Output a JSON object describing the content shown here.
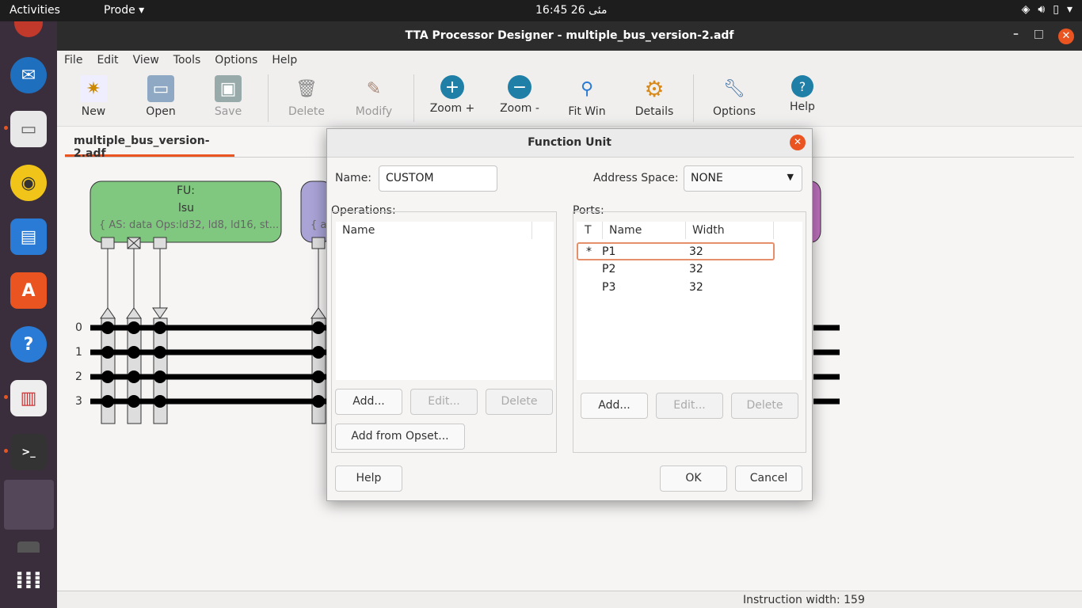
{
  "topbar": {
    "activities": "Activities",
    "app_menu": "Prode ▾",
    "clock": "16:45  مئی 26"
  },
  "window": {
    "title": "TTA Processor Designer - multiple_bus_version-2.adf",
    "minimize": "–",
    "maximize": "□",
    "close": "✕"
  },
  "menu": [
    "File",
    "Edit",
    "View",
    "Tools",
    "Options",
    "Help"
  ],
  "toolbar": {
    "new": "New",
    "open": "Open",
    "save": "Save",
    "delete": "Delete",
    "modify": "Modify",
    "zoom_in": "Zoom +",
    "zoom_out": "Zoom -",
    "fit": "Fit Win",
    "details": "Details",
    "options": "Options",
    "help": "Help"
  },
  "tab": "multiple_bus_version-2.adf",
  "canvas": {
    "fu_title": "FU:",
    "fu_name": "lsu",
    "fu_info": "{ AS: data Ops:ld32, ld8, ld16, st...",
    "fu2_info": "{ a",
    "buses": [
      "0",
      "1",
      "2",
      "3"
    ]
  },
  "status": "Instruction width: 159",
  "dialog": {
    "title": "Function Unit",
    "close": "✕",
    "name_label": "Name:",
    "name_value": "CUSTOM",
    "as_label": "Address Space:",
    "as_value": "NONE",
    "operations_label": "Operations:",
    "ops_col": "Name",
    "ops_add": "Add...",
    "ops_edit": "Edit...",
    "ops_delete": "Delete",
    "ops_opset": "Add from  Opset...",
    "ports_label": "Ports:",
    "ports_cols": {
      "t": "T",
      "name": "Name",
      "width": "Width"
    },
    "ports": [
      {
        "t": "*",
        "name": "P1",
        "width": "32"
      },
      {
        "t": "",
        "name": "P2",
        "width": "32"
      },
      {
        "t": "",
        "name": "P3",
        "width": "32"
      }
    ],
    "ports_add": "Add...",
    "ports_edit": "Edit...",
    "ports_delete": "Delete",
    "help": "Help",
    "ok": "OK",
    "cancel": "Cancel"
  }
}
